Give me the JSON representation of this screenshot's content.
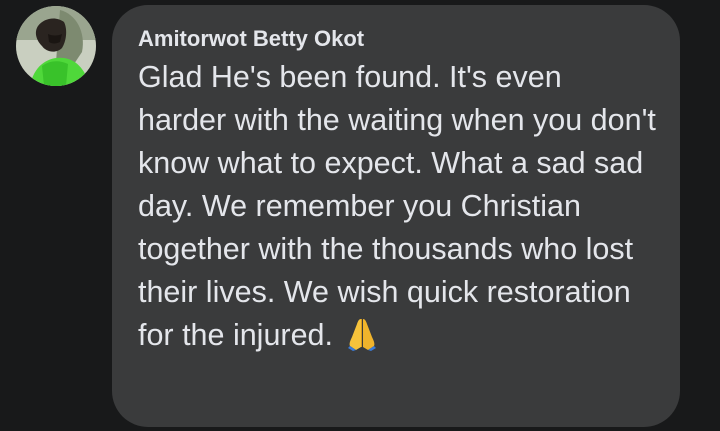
{
  "comment": {
    "author": "Amitorwot Betty Okot",
    "text": "Glad He's been found. It's even harder with the waiting when you don't know what to expect. What a sad sad day. We remember you Christian together with the thousands who lost their lives. We wish quick restoration for the injured.",
    "emoji_icon": "folded-hands-icon"
  },
  "colors": {
    "background": "#18191a",
    "bubble": "#3a3b3c",
    "text": "#e4e6eb"
  }
}
